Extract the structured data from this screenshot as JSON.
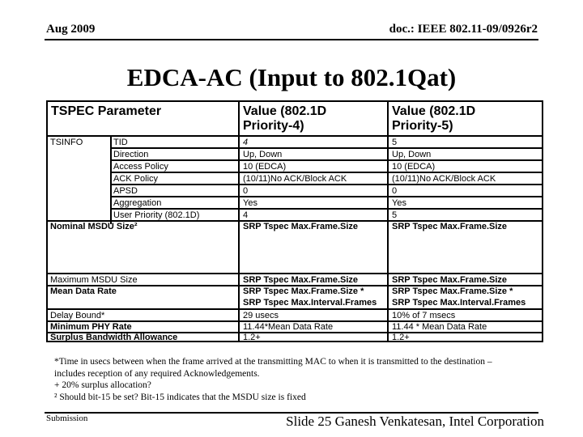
{
  "header": {
    "date": "Aug 2009",
    "doc_id": "doc.: IEEE 802.11-09/0926r2"
  },
  "title": "EDCA-AC (Input to 802.1Qat)",
  "table": {
    "headers": [
      "TSPEC Parameter",
      "Value (802.1D",
      "Priority-4)",
      "Value (802.1D",
      "Priority-5)"
    ],
    "tsinfo_label": "TSINFO",
    "tsinfo_rows": [
      {
        "param": "TID",
        "p4": "4",
        "p5": "5"
      },
      {
        "param": "Direction",
        "p4": "Up, Down",
        "p5": "Up, Down"
      },
      {
        "param": "Access Policy",
        "p4": "10 (EDCA)",
        "p5": "10 (EDCA)"
      },
      {
        "param": "ACK Policy",
        "p4": "(10/11)No ACK/Block ACK",
        "p5": "(10/11)No ACK/Block ACK"
      },
      {
        "param": "APSD",
        "p4": "0",
        "p5": "0"
      },
      {
        "param": "Aggregation",
        "p4": "Yes",
        "p5": "Yes"
      },
      {
        "param": "User Priority (802.1D)",
        "p4": "4",
        "p5": "5"
      }
    ],
    "nominal": {
      "param": "Nominal MSDU Size²",
      "p4": "SRP Tspec Max.Frame.Size",
      "p5": "SRP Tspec Max.Frame.Size"
    },
    "max_msdu": {
      "param": "Maximum MSDU Size",
      "p4": "SRP Tspec Max.Frame.Size",
      "p5": "SRP Tspec Max.Frame.Size"
    },
    "mean_rate": {
      "param": "Mean Data Rate",
      "p4_1": "SRP Tspec Max.Frame.Size *",
      "p4_2": "SRP Tspec Max.Interval.Frames",
      "p5_1": "SRP Tspec Max.Frame.Size *",
      "p5_2": "SRP Tspec Max.Interval.Frames"
    },
    "delay": {
      "param": "Delay Bound*",
      "p4": "29 usecs",
      "p5": "10% of 7 msecs"
    },
    "min_phy": {
      "param": "Minimum PHY Rate",
      "p4": "11.44*Mean Data Rate",
      "p5": "11.44 * Mean Data Rate"
    },
    "surplus": {
      "param": "Surplus Bandwidth Allowance",
      "p4": "1.2+",
      "p5": "1.2+"
    }
  },
  "footnotes": [
    "*Time in usecs between when the frame arrived at the transmitting MAC to when it is transmitted to the destination –",
    "includes reception of  any required Acknowledgements.",
    "+ 20% surplus allocation?",
    "² Should bit-15 be set? Bit-15 indicates that the MSDU size is fixed"
  ],
  "footer": {
    "left": "Submission",
    "right": "Slide 25 Ganesh Venkatesan, Intel Corporation"
  }
}
